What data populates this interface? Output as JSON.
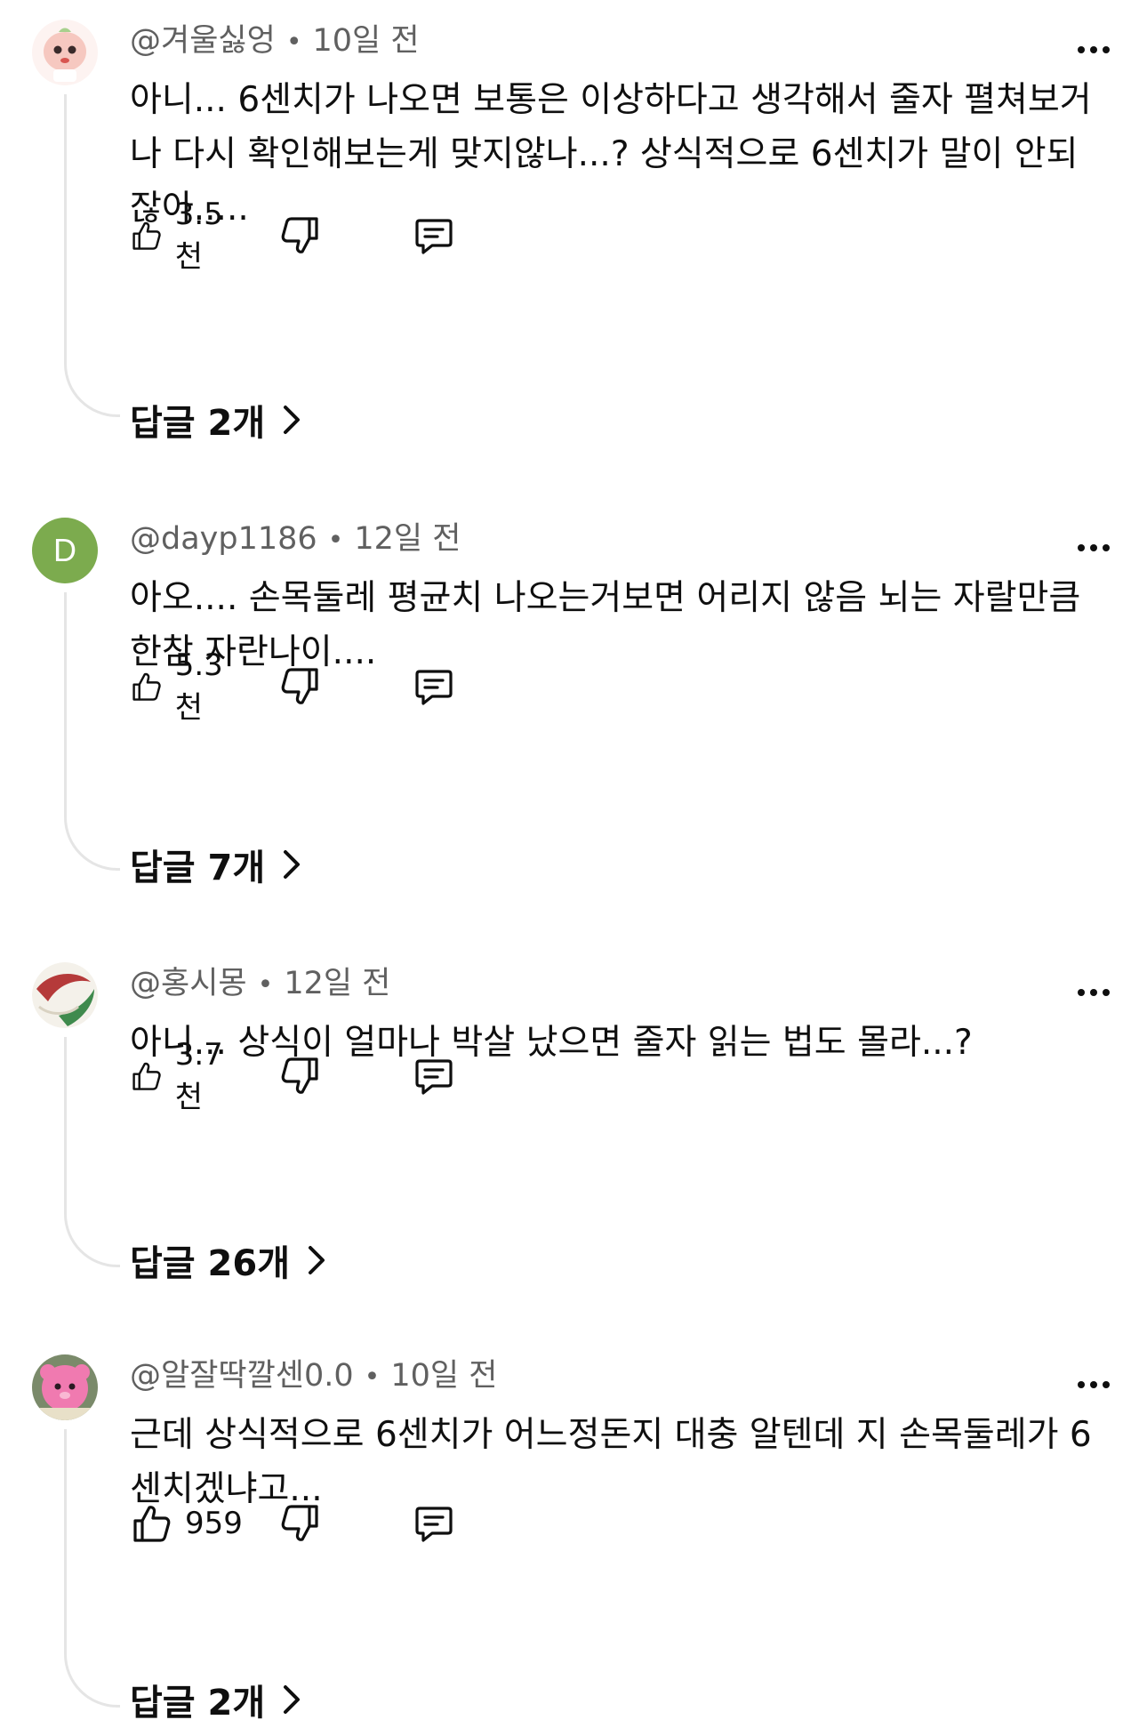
{
  "comments": [
    {
      "author": "@겨울싫엉",
      "time": "10일 전",
      "text": "아니... 6센치가 나오면 보통은 이상하다고 생각해서 줄자 펼쳐보거나 다시 확인해보는게 맞지않나...? 상식적으로 6센치가 말이 안되잖아.....",
      "likes": "3.5천",
      "replies": "답글 2개"
    },
    {
      "author": "@dayp1186",
      "time": "12일 전",
      "avatar_letter": "D",
      "text": "아오.... 손목둘레 평균치 나오는거보면 어리지 않음 뇌는 자랄만큼 한참 자란나이....",
      "likes": "5.3천",
      "replies": "답글 7개"
    },
    {
      "author": "@홍시몽",
      "time": "12일 전",
      "text": "아니... 상식이 얼마나 박살 났으면 줄자 읽는 법도 몰라...?",
      "likes": "3.7천",
      "replies": "답글 26개"
    },
    {
      "author": "@알잘딱깔센0.0",
      "time": "10일 전",
      "text": "근데 상식적으로 6센치가 어느정돈지 대충 알텐데 지 손목둘레가 6센치겠냐고...",
      "likes": "959",
      "replies": "답글 2개"
    }
  ],
  "icons": {
    "like": "thumbs-up-icon",
    "dislike": "thumbs-down-icon",
    "reply": "comment-icon",
    "more": "more-horizontal-icon",
    "chevron": "chevron-right-icon"
  },
  "colors": {
    "avatar_d": "#7cab4e",
    "meta_text": "#606060",
    "thread_line": "#e5e5e5"
  }
}
